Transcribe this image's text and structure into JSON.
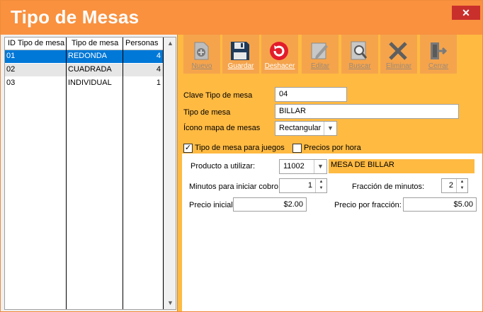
{
  "window": {
    "title": "Tipo de Mesas",
    "close_label": "✕"
  },
  "grid": {
    "columns": [
      "ID Tipo de mesa",
      "Tipo de mesa",
      "Personas"
    ],
    "rows": [
      {
        "id": "01",
        "tipo": "REDONDA",
        "personas": "4"
      },
      {
        "id": "02",
        "tipo": "CUADRADA",
        "personas": "4"
      },
      {
        "id": "03",
        "tipo": "INDIVIDUAL",
        "personas": "1"
      }
    ]
  },
  "toolbar": {
    "nuevo": "Nuevo",
    "guardar": "Guardar",
    "deshacer": "Deshacer",
    "editar": "Editar",
    "buscar": "Buscar",
    "eliminar": "Eliminar",
    "cerrar": "Cerrar"
  },
  "form": {
    "clave_label": "Clave Tipo de mesa",
    "clave_value": "04",
    "tipo_label": "Tipo de mesa",
    "tipo_value": "BILLAR",
    "icono_label": "Ícono mapa de mesas",
    "icono_value": "Rectangular",
    "juegos_label": "Tipo de mesa para juegos",
    "juegos_checked": true,
    "hora_label": "Precios por hora",
    "hora_checked": false
  },
  "juegos": {
    "producto_label": "Producto a utilizar:",
    "producto_value": "11002",
    "producto_name": "MESA DE BILLAR",
    "minutos_label": "Minutos para iniciar cobro:",
    "minutos_value": "1",
    "fraccion_label": "Fracción de minutos:",
    "fraccion_value": "2",
    "precio_inicial_label": "Precio inicial:",
    "precio_inicial_value": "$2.00",
    "precio_fraccion_label": "Precio por fracción:",
    "precio_fraccion_value": "$5.00"
  },
  "colors": {
    "titlebar": "#f9913f",
    "panel": "#ffba42",
    "selection": "#0078d7",
    "close": "#c9302c"
  }
}
